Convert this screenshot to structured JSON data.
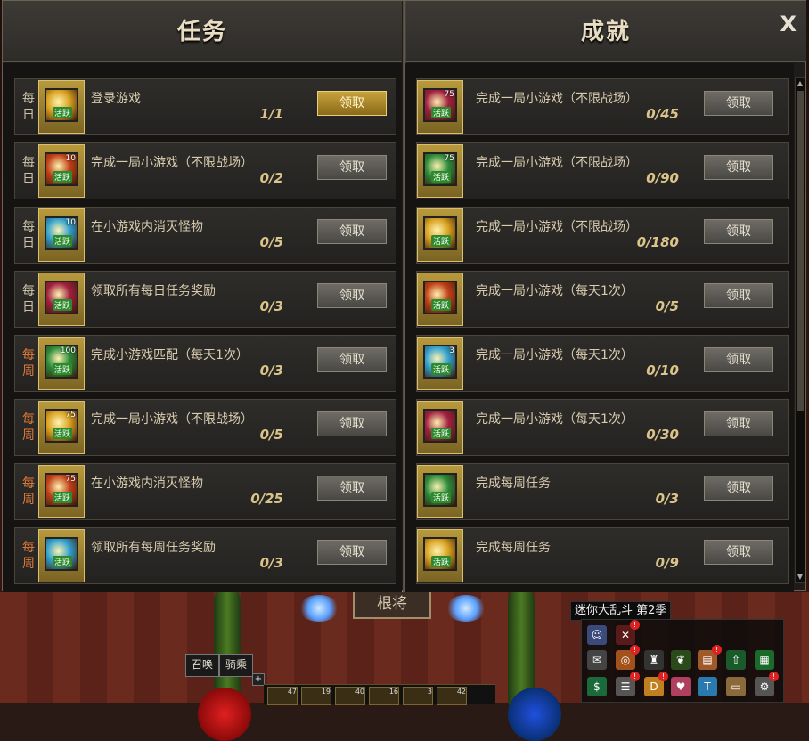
{
  "tasks_tab": {
    "title": "任务"
  },
  "achievements_tab": {
    "title": "成就"
  },
  "close_label": "X",
  "claim_label": "领取",
  "activity_label": "活跃",
  "tasks": [
    {
      "period": "每日",
      "type": "daily",
      "num": "",
      "title": "登录游戏",
      "progress": "1/1",
      "claimable": true
    },
    {
      "period": "每日",
      "type": "daily",
      "num": "10",
      "title": "完成一局小游戏（不限战场）",
      "progress": "0/2",
      "claimable": false
    },
    {
      "period": "每日",
      "type": "daily",
      "num": "10",
      "title": "在小游戏内消灭怪物",
      "progress": "0/5",
      "claimable": false
    },
    {
      "period": "每日",
      "type": "daily",
      "num": "",
      "title": "领取所有每日任务奖励",
      "progress": "0/3",
      "claimable": false
    },
    {
      "period": "每周",
      "type": "weekly",
      "num": "100",
      "title": "完成小游戏匹配（每天1次）",
      "progress": "0/3",
      "claimable": false
    },
    {
      "period": "每周",
      "type": "weekly",
      "num": "75",
      "title": "完成一局小游戏（不限战场）",
      "progress": "0/5",
      "claimable": false
    },
    {
      "period": "每周",
      "type": "weekly",
      "num": "75",
      "title": "在小游戏内消灭怪物",
      "progress": "0/25",
      "claimable": false
    },
    {
      "period": "每周",
      "type": "weekly",
      "num": "",
      "title": "领取所有每周任务奖励",
      "progress": "0/3",
      "claimable": false
    }
  ],
  "achievements": [
    {
      "num": "75",
      "title": "完成一局小游戏（不限战场）",
      "progress": "0/45"
    },
    {
      "num": "75",
      "title": "完成一局小游戏（不限战场）",
      "progress": "0/90"
    },
    {
      "num": "",
      "title": "完成一局小游戏（不限战场）",
      "progress": "0/180"
    },
    {
      "num": "",
      "title": "完成一局小游戏（每天1次）",
      "progress": "0/5"
    },
    {
      "num": "3",
      "title": "完成一局小游戏（每天1次）",
      "progress": "0/10"
    },
    {
      "num": "",
      "title": "完成一局小游戏（每天1次）",
      "progress": "0/30"
    },
    {
      "num": "",
      "title": "完成每周任务",
      "progress": "0/3"
    },
    {
      "num": "",
      "title": "完成每周任务",
      "progress": "0/9"
    }
  ],
  "scene": {
    "sign_text": "根将"
  },
  "hud": {
    "event_title": "迷你大乱斗 第2季",
    "summon_label": "召唤",
    "ride_label": "骑乘",
    "plus_label": "+",
    "skill_counts": [
      "47",
      "19",
      "40",
      "16",
      "3",
      "42"
    ]
  }
}
